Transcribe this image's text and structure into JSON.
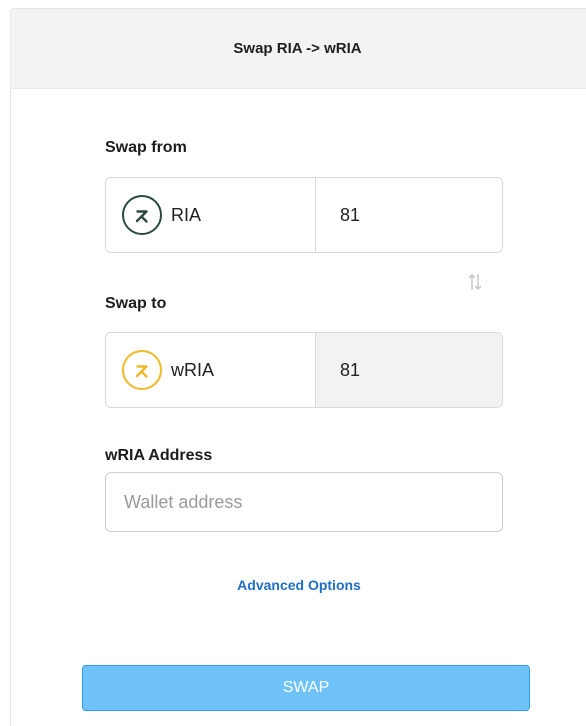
{
  "header": {
    "title": "Swap RIA -> wRIA"
  },
  "swap_from": {
    "label": "Swap from",
    "token": "RIA",
    "token_icon": "ria-coin-icon",
    "amount": "81"
  },
  "swap_to": {
    "label": "Swap to",
    "token": "wRIA",
    "token_icon": "wria-coin-icon",
    "amount": "81"
  },
  "address": {
    "label": "wRIA Address",
    "value": "",
    "placeholder": "Wallet address"
  },
  "advanced_options": "Advanced Options",
  "swap_button": "SWAP",
  "colors": {
    "ria_coin": "#2a4a3a",
    "wria_coin": "#f0b928",
    "link": "#1f6fc5",
    "swap_button_bg": "#6ec2f7",
    "header_bg": "#f2f3f4"
  }
}
